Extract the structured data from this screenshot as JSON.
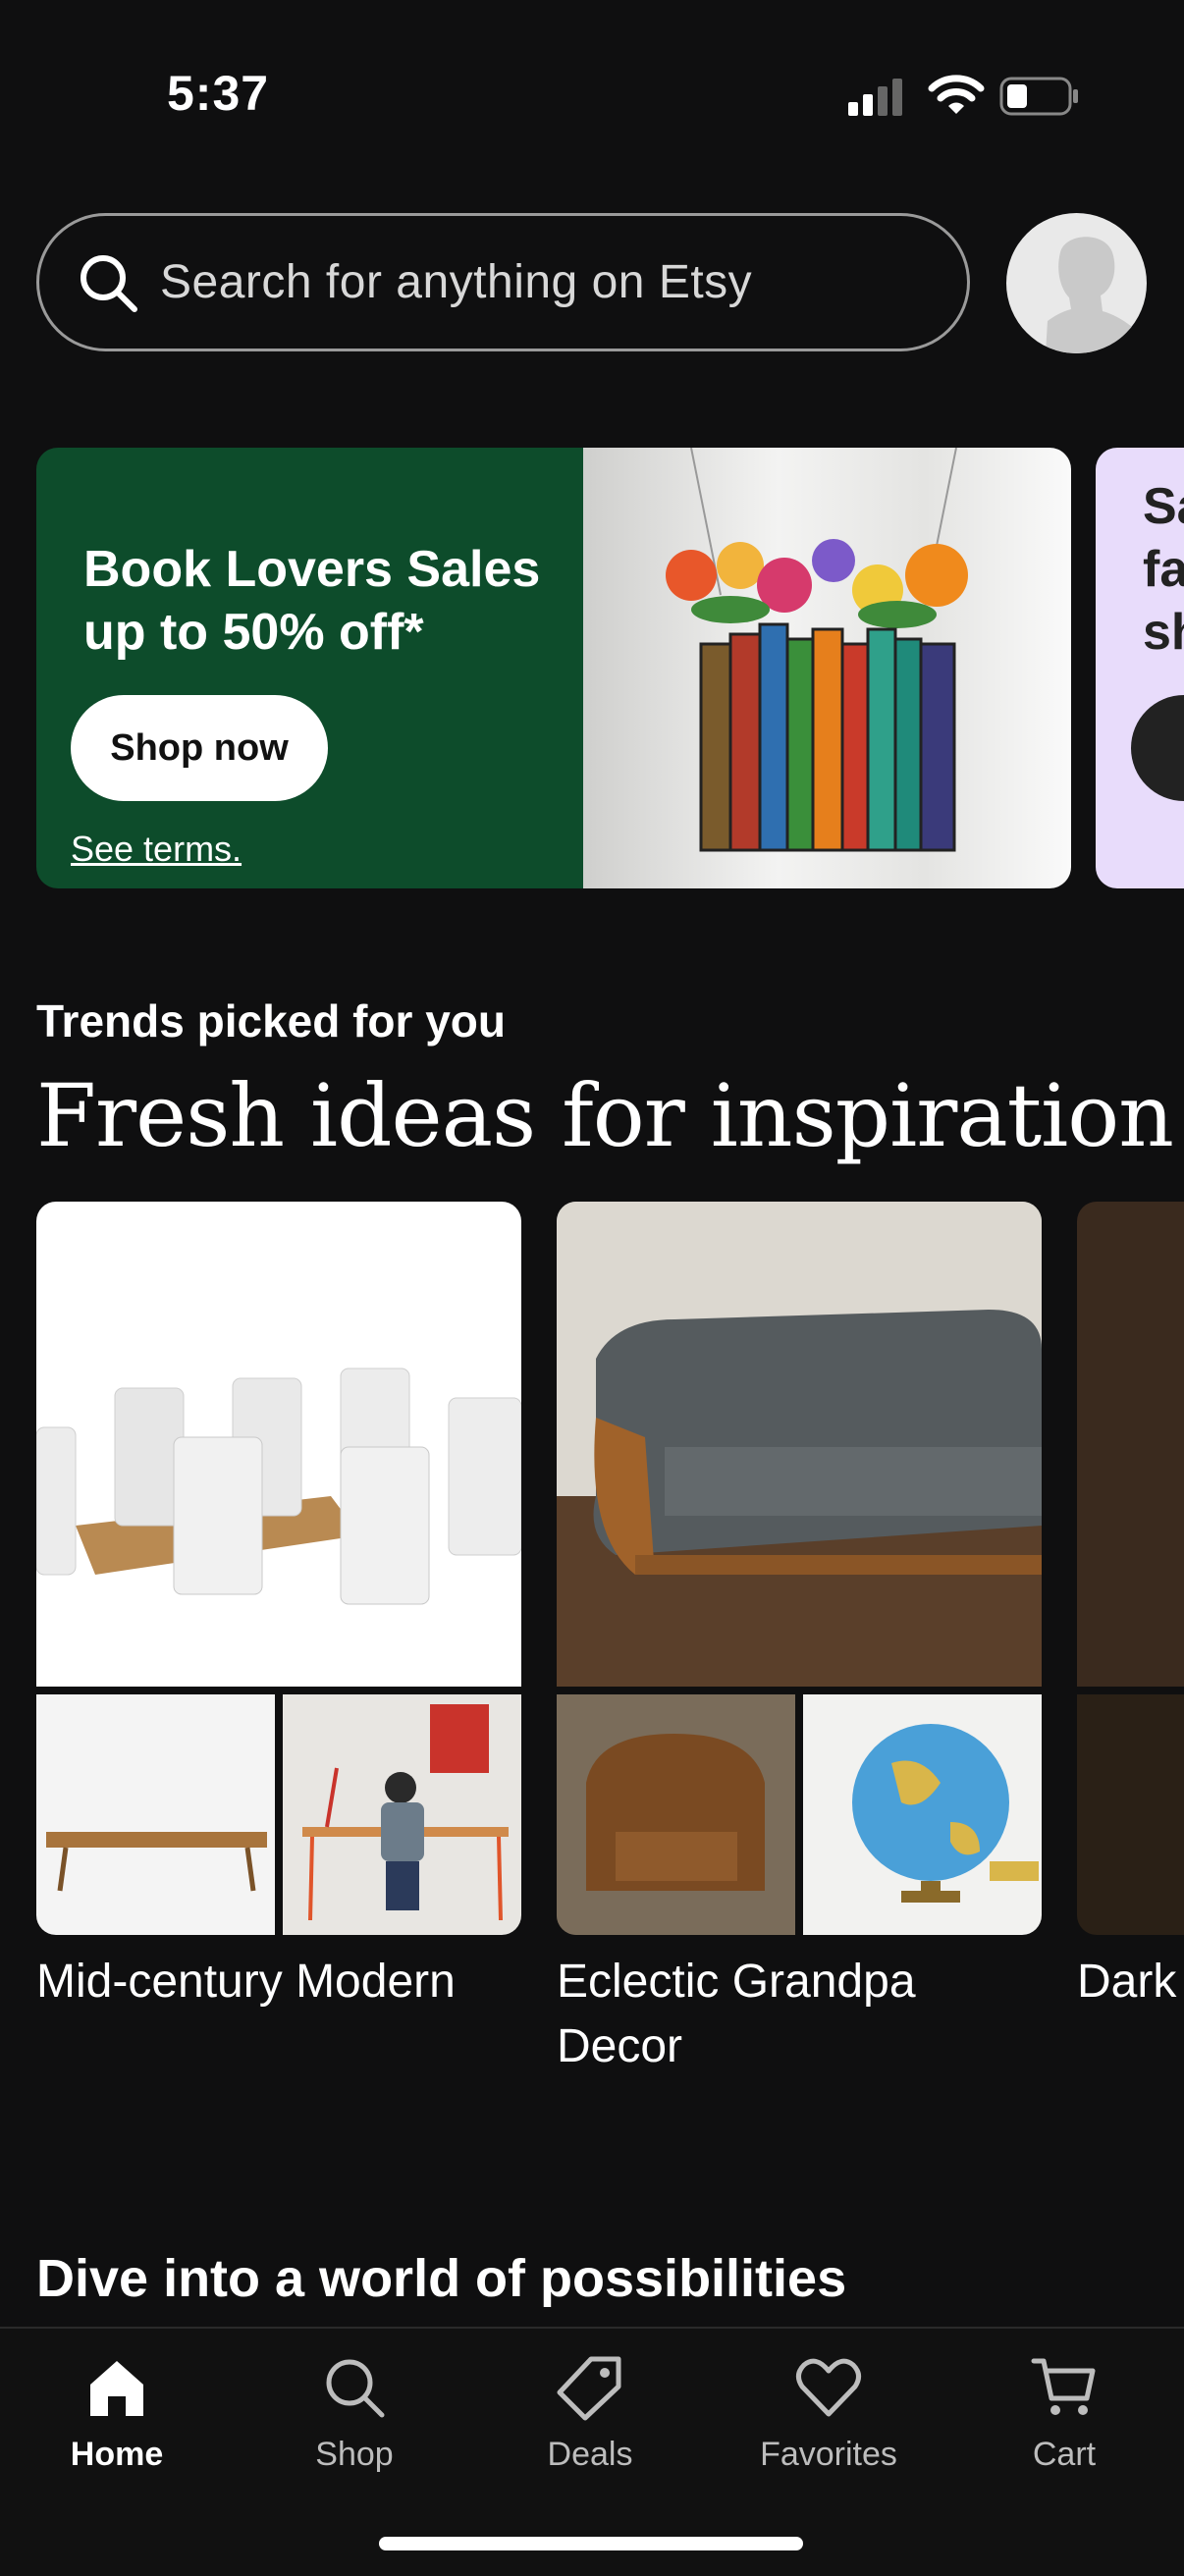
{
  "status_bar": {
    "time": "5:37"
  },
  "search": {
    "placeholder": "Search for anything on Etsy"
  },
  "banner": {
    "title": "Book Lovers Sales up to 50% off*",
    "button_label": "Shop now",
    "terms_link": "See terms.",
    "bg_color": "#0d4c2b"
  },
  "banner2": {
    "partial_text": "Sa\nfa\nsh"
  },
  "trends": {
    "subtitle": "Trends picked for you",
    "title": "Fresh ideas for inspiration",
    "cards": [
      {
        "label": "Mid-century Modern"
      },
      {
        "label": "Eclectic Grandpa Decor"
      },
      {
        "label": "Dark Decor"
      }
    ]
  },
  "explore": {
    "title": "Dive into a world of possibilities"
  },
  "tabbar": {
    "items": [
      {
        "label": "Home",
        "icon": "home-icon",
        "active": true
      },
      {
        "label": "Shop",
        "icon": "search-icon",
        "active": false
      },
      {
        "label": "Deals",
        "icon": "tag-icon",
        "active": false
      },
      {
        "label": "Favorites",
        "icon": "heart-icon",
        "active": false
      },
      {
        "label": "Cart",
        "icon": "cart-icon",
        "active": false
      }
    ]
  }
}
